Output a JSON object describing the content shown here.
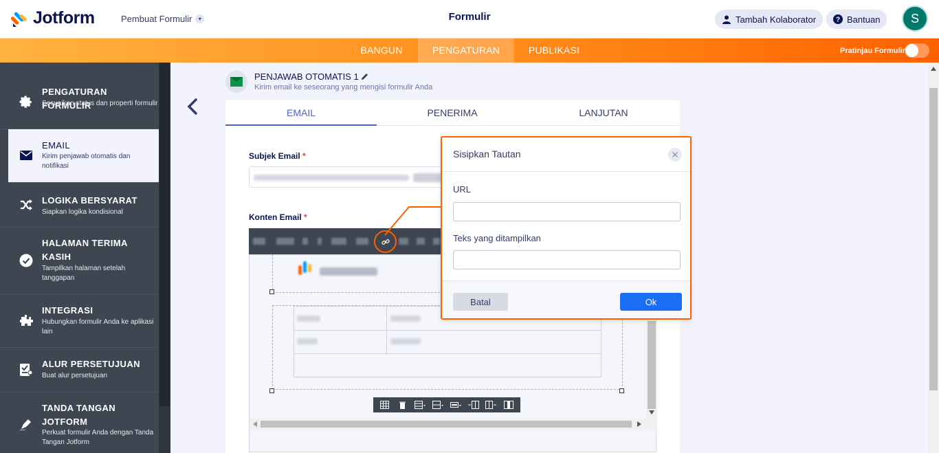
{
  "brand": {
    "name": "Jotform"
  },
  "header": {
    "builder_menu": "Pembuat Formulir",
    "form_title": "Formulir",
    "collaborator_btn": "Tambah Kolaborator",
    "help_btn": "Bantuan",
    "avatar_letter": "S"
  },
  "nav": {
    "tabs": [
      "BANGUN",
      "PENGATURAN",
      "PUBLIKASI"
    ],
    "active_tab": "PENGATURAN",
    "preview_label": "Pratinjau Formulir",
    "preview_enabled": false
  },
  "sidebar": {
    "items": [
      {
        "title": "PENGATURAN FORMULIR",
        "sub": "Sesuaikan status dan properti formulir",
        "icon": "gear-icon"
      },
      {
        "title": "EMAIL",
        "sub": "Kirim penjawab otomatis dan notifikasi",
        "icon": "envelope-icon",
        "active": true
      },
      {
        "title": "LOGIKA BERSYARAT",
        "sub": "Siapkan logika kondisional",
        "icon": "shuffle-icon"
      },
      {
        "title": "HALAMAN TERIMA KASIH",
        "sub": "Tampilkan halaman setelah tanggapan",
        "icon": "check-circle-icon"
      },
      {
        "title": "INTEGRASI",
        "sub": "Hubungkan formulir Anda ke aplikasi lain",
        "icon": "puzzle-icon"
      },
      {
        "title": "ALUR PERSETUJUAN",
        "sub": "Buat alur persetujuan",
        "icon": "approval-icon"
      },
      {
        "title": "TANDA TANGAN JOTFORM",
        "sub": "Perkuat formulir Anda dengan Tanda Tangan Jotform",
        "icon": "pen-icon"
      }
    ]
  },
  "autoresponder": {
    "title": "PENJAWAB OTOMATIS 1",
    "subtitle": "Kirim email ke seseorang yang mengisi formulir Anda"
  },
  "email_tabs": [
    "EMAIL",
    "PENERIMA",
    "LANJUTAN"
  ],
  "fields": {
    "subject_label": "Subjek Email",
    "content_label": "Konten Email",
    "required_mark": "*"
  },
  "modal": {
    "title": "Sisipkan Tautan",
    "url_label": "URL",
    "url_value": "",
    "display_label": "Teks yang ditampilkan",
    "display_value": "",
    "cancel": "Batal",
    "ok": "Ok"
  },
  "colors": {
    "accent_orange": "#ff6100",
    "brand_navy": "#0a1551",
    "ok_blue": "#1a6ef5",
    "sidebar_bg": "#3e4652"
  }
}
